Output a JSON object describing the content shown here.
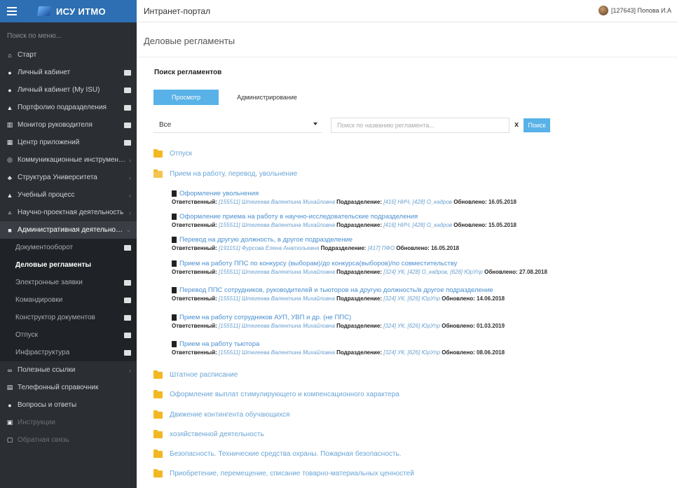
{
  "sidebar": {
    "brand": "ИСУ ИТМО",
    "search_placeholder": "Поиск по меню...",
    "items": [
      {
        "label": "Старт",
        "icon": "home-icon",
        "ext": false,
        "chev": false
      },
      {
        "label": "Личный кабинет",
        "icon": "user-icon",
        "ext": true,
        "chev": false
      },
      {
        "label": "Личный кабинет (My ISU)",
        "icon": "user-icon",
        "ext": true,
        "chev": false
      },
      {
        "label": "Портфолио подразделения",
        "icon": "graduation-icon",
        "ext": true,
        "chev": false
      },
      {
        "label": "Монитор руководителя",
        "icon": "bank-icon",
        "ext": true,
        "chev": false
      },
      {
        "label": "Центр приложений",
        "icon": "grid-icon",
        "ext": true,
        "chev": false
      },
      {
        "label": "Коммуникационные инструменты",
        "icon": "chat-icon",
        "ext": false,
        "chev": true
      },
      {
        "label": "Структура Университета",
        "icon": "sitemap-icon",
        "ext": false,
        "chev": true
      },
      {
        "label": "Учебный процесс",
        "icon": "graduation-icon",
        "ext": false,
        "chev": true
      },
      {
        "label": "Научно-проектная деятельность",
        "icon": "flask-icon",
        "ext": false,
        "chev": true
      },
      {
        "label": "Административная деятельность",
        "icon": "briefcase-icon",
        "ext": false,
        "chev": true
      }
    ],
    "sub_items": [
      {
        "label": "Документооборот",
        "ext": true
      },
      {
        "label": "Деловые регламенты",
        "ext": false
      },
      {
        "label": "Электронные заявки",
        "ext": true
      },
      {
        "label": "Командировки",
        "ext": true
      },
      {
        "label": "Конструктор документов",
        "ext": true
      },
      {
        "label": "Отпуск",
        "ext": true
      },
      {
        "label": "Инфраструктура",
        "ext": true
      }
    ],
    "bottom_items": [
      {
        "label": "Полезные ссылки",
        "icon": "link-icon",
        "chev": true
      },
      {
        "label": "Телефонный справочник",
        "icon": "phone-book-icon",
        "chev": false
      },
      {
        "label": "Вопросы и ответы",
        "icon": "question-icon",
        "chev": false
      },
      {
        "label": "Инструкции",
        "icon": "book-icon",
        "chev": false
      },
      {
        "label": "Обратная связь",
        "icon": "feedback-icon",
        "chev": false
      }
    ]
  },
  "topbar": {
    "title": "Интранет-портал",
    "user": "[127643] Попова И.А"
  },
  "page": {
    "heading": "Деловые регламенты",
    "section_title": "Поиск регламентов",
    "tabs": [
      "Просмотр",
      "Администрирование"
    ],
    "filter_value": "Все",
    "search_placeholder": "Поиск по названию регламента...",
    "clear_label": "x",
    "search_button": "Поиск"
  },
  "tree": {
    "folders_top": [
      {
        "label": "Отпуск",
        "open": false
      },
      {
        "label": "Прием на работу, перевод, увольнение",
        "open": true
      }
    ],
    "docs": [
      {
        "title": "Оформление увольнения",
        "resp_label": "Ответственный:",
        "resp": "[155511] Штегеева Валентина Михайловна",
        "dept_label": "Подразделение:",
        "dept": "[416] НИЧ, [428] О_кадров",
        "upd_label": "Обновлено:",
        "upd": "16.05.2018"
      },
      {
        "title": "Оформление приема на работу в научно-исследовательские подразделения",
        "resp_label": "Ответственный:",
        "resp": "[155511] Штегеева Валентина Михайловна",
        "dept_label": "Подразделение:",
        "dept": "[416] НИЧ, [428] О_кадров",
        "upd_label": "Обновлено:",
        "upd": "15.05.2018"
      },
      {
        "title": "Перевод на другую должность, в другое подразделение",
        "resp_label": "Ответственный:",
        "resp": "[191151] Фурсова Елена Анатольевна",
        "dept_label": "Подразделение:",
        "dept": "[417] ПФО",
        "upd_label": "Обновлено:",
        "upd": "16.05.2018"
      },
      {
        "title": "Прием на работу ППС по конкурсу (выборам)/до конкурса(выборов)/по совместительству",
        "resp_label": "Ответственный:",
        "resp": "[155511] Штегеева Валентина Михайловна",
        "dept_label": "Подразделение:",
        "dept": "[324] УК, [428] О_кадров, [626] ЮрУпр",
        "upd_label": "Обновлено:",
        "upd": "27.08.2018"
      },
      {
        "title": "Перевод ППС сотрудников, руководителей и тьюторов на другую должность/в другое подразделение",
        "resp_label": "Ответственный:",
        "resp": "[155511] Штегеева Валентина Михайловна",
        "dept_label": "Подразделение:",
        "dept": "[324] УК, [626] ЮрУпр",
        "upd_label": "Обновлено:",
        "upd": "14.06.2018"
      },
      {
        "title": "Прием на работу сотрудников АУП, УВП и др. (не ППС)",
        "resp_label": "Ответственный:",
        "resp": "[155511] Штегеева Валентина Михайловна",
        "dept_label": "Подразделение:",
        "dept": "[324] УК, [626] ЮрУпр",
        "upd_label": "Обновлено:",
        "upd": "01.03.2019"
      },
      {
        "title": "Прием на работу тьютора",
        "resp_label": "Ответственный:",
        "resp": "[155511] Штегеева Валентина Михайловна",
        "dept_label": "Подразделение:",
        "dept": "[324] УК, [626] ЮрУпр",
        "upd_label": "Обновлено:",
        "upd": "08.06.2018"
      }
    ],
    "folders_bottom": [
      "Штатное расписание",
      "Оформление выплат стимулирующего и компенсационного характера",
      "Движение контингента обучающихся",
      "хозяйственной деятельность",
      "Безопасность. Технические средства охраны. Пожарная безопасность.",
      "Приобретение, перемещение, списание товарно-материальных ценностей"
    ]
  },
  "colors": {
    "brand": "#2d6fb2",
    "sidebar": "#2b2e33",
    "accent": "#58b2e7",
    "link": "#4a8fcf",
    "folder": "#f2b824"
  }
}
